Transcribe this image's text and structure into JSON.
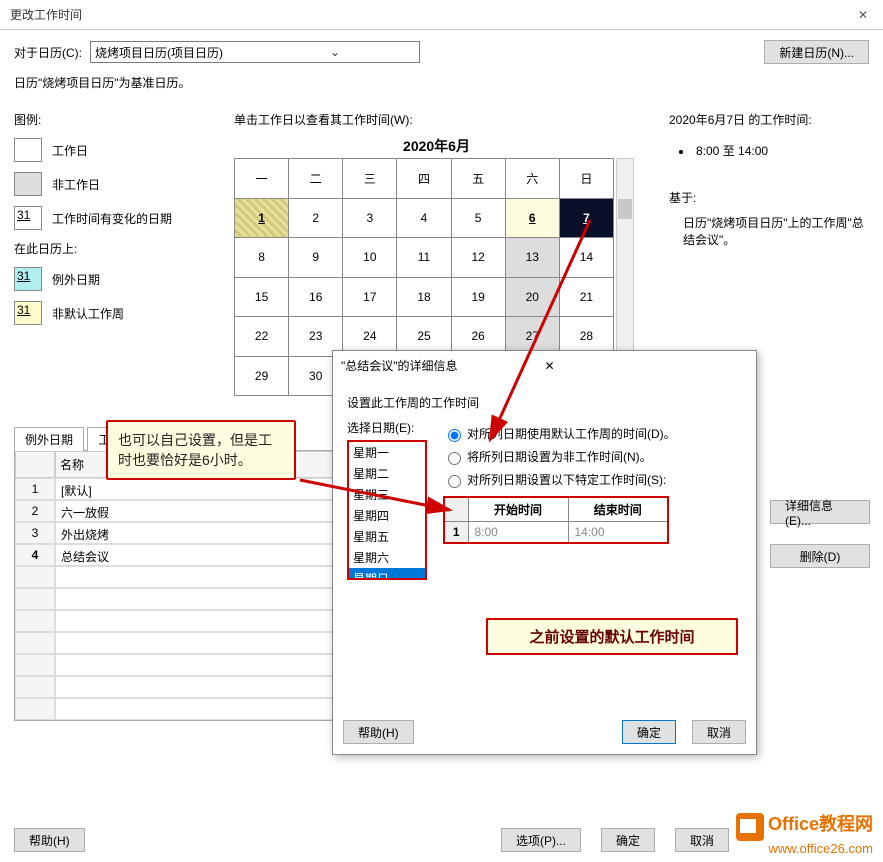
{
  "window": {
    "title": "更改工作时间"
  },
  "toolbar": {
    "forCalendarLabel": "对于日历(C):",
    "calendarName": "烧烤项目日历(项目日历)",
    "newCalendar": "新建日历(N)..."
  },
  "baseNote": "日历\"烧烤项目日历\"为基准日历。",
  "legend": {
    "heading": "图例:",
    "workday": "工作日",
    "nonworkday": "非工作日",
    "changed": "工作时间有变化的日期",
    "changedNum": "31",
    "onThis": "在此日历上:",
    "exception": "例外日期",
    "exceptionNum": "31",
    "nondefault": "非默认工作周",
    "nondefaultNum": "31"
  },
  "calendar": {
    "heading": "单击工作日以查看其工作时间(W):",
    "monthTitle": "2020年6月",
    "dow": [
      "一",
      "二",
      "三",
      "四",
      "五",
      "六",
      "日"
    ],
    "rows": [
      [
        "1",
        "2",
        "3",
        "4",
        "5",
        "6",
        "7"
      ],
      [
        "8",
        "9",
        "10",
        "11",
        "12",
        "13",
        "14"
      ],
      [
        "15",
        "16",
        "17",
        "18",
        "19",
        "20",
        "21"
      ],
      [
        "22",
        "23",
        "24",
        "25",
        "26",
        "27",
        "28"
      ],
      [
        "29",
        "30",
        "",
        "",
        "",
        "",
        ""
      ]
    ]
  },
  "info": {
    "heading": "2020年6月7日 的工作时间:",
    "hours": "8:00 至 14:00",
    "basedOn": "基于:",
    "basedOnDetail": "日历\"烧烤项目日历\"上的工作周\"总结会议\"。"
  },
  "tabs": {
    "exceptions": "例外日期",
    "workweeks": "工"
  },
  "list": {
    "colName": "名称",
    "rows": [
      {
        "n": "1",
        "name": "[默认]"
      },
      {
        "n": "2",
        "name": "六一放假"
      },
      {
        "n": "3",
        "name": "外出烧烤"
      },
      {
        "n": "4",
        "name": "总结会议"
      }
    ]
  },
  "buttons": {
    "details": "详细信息(E)...",
    "delete": "删除(D)",
    "help": "帮助(H)",
    "options": "选项(P)...",
    "ok": "确定",
    "cancel": "取消"
  },
  "modal": {
    "title": "\"总结会议\"的详细信息",
    "setLabel": "设置此工作周的工作时间",
    "selectDay": "选择日期(E):",
    "days": [
      "星期一",
      "星期二",
      "星期三",
      "星期四",
      "星期五",
      "星期六",
      "星期日"
    ],
    "opt1": "对所列日期使用默认工作周的时间(D)。",
    "opt2": "将所列日期设置为非工作时间(N)。",
    "opt3": "对所列日期设置以下特定工作时间(S):",
    "startHeader": "开始时间",
    "endHeader": "结束时间",
    "rowNum": "1",
    "start": "8:00",
    "end": "14:00",
    "help": "帮助(H)",
    "ok": "确定",
    "cancel": "取消"
  },
  "callout1": "也可以自己设置，但是工时也要恰好是6小时。",
  "callout2": "之前设置的默认工作时间",
  "watermark": {
    "line1": "Office教程网",
    "line2": "www.office26.com"
  }
}
